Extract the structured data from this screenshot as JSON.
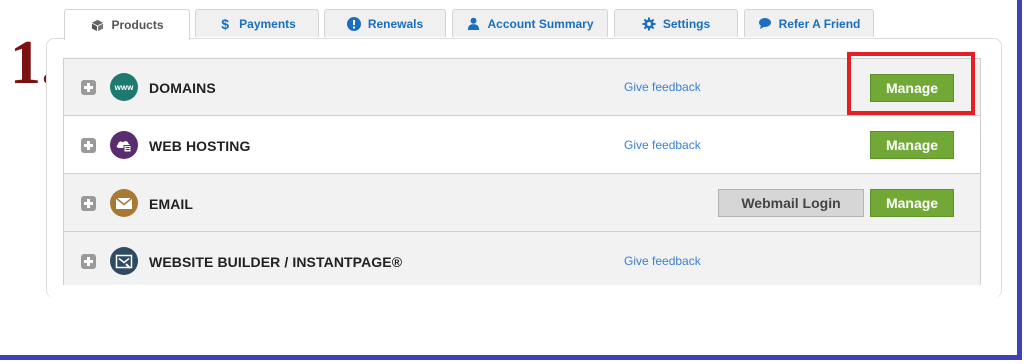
{
  "step_label": "1.",
  "tabs": [
    {
      "label": "Products",
      "icon": "box-icon",
      "active": true
    },
    {
      "label": "Payments",
      "icon": "dollar-icon",
      "active": false
    },
    {
      "label": "Renewals",
      "icon": "alert-icon",
      "active": false
    },
    {
      "label": "Account Summary",
      "icon": "user-icon",
      "active": false
    },
    {
      "label": "Settings",
      "icon": "gear-icon",
      "active": false
    },
    {
      "label": "Refer A Friend",
      "icon": "chat-icon",
      "active": false
    }
  ],
  "products": [
    {
      "title": "DOMAINS",
      "icon": "www-globe-icon",
      "feedback": "Give feedback",
      "manage": "Manage"
    },
    {
      "title": "WEB HOSTING",
      "icon": "hosting-cloud-icon",
      "feedback": "Give feedback",
      "manage": "Manage"
    },
    {
      "title": "EMAIL",
      "icon": "envelope-icon",
      "webmail": "Webmail Login",
      "manage": "Manage"
    },
    {
      "title": "WEBSITE BUILDER / INSTANTPAGE®",
      "icon": "website-builder-icon",
      "feedback": "Give feedback"
    }
  ],
  "colors": {
    "accent_green": "#72a936",
    "link_blue": "#3a7fd5",
    "tab_blue": "#1a6fbf",
    "highlight_red": "#e31e24",
    "frame_blue": "#3e42b8",
    "step_red": "#7a1212"
  }
}
